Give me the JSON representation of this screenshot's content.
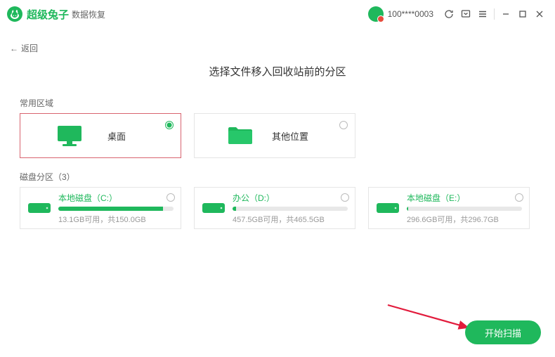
{
  "titlebar": {
    "brand": "超级兔子",
    "subbrand": "数据恢复",
    "user_id": "100****0003"
  },
  "back": {
    "label": "返回"
  },
  "page_title": "选择文件移入回收站前的分区",
  "sections": {
    "common_label": "常用区域",
    "partition_label": "磁盘分区（3）"
  },
  "common_cards": [
    {
      "name": "桌面",
      "selected": true
    },
    {
      "name": "其他位置",
      "selected": false
    }
  ],
  "drives": [
    {
      "name": "本地磁盘（C:）",
      "stat": "13.1GB可用，共150.0GB",
      "fill_pct": 91
    },
    {
      "name": "办公（D:）",
      "stat": "457.5GB可用，共465.5GB",
      "fill_pct": 3
    },
    {
      "name": "本地磁盘（E:）",
      "stat": "296.6GB可用，共296.7GB",
      "fill_pct": 1
    }
  ],
  "scan_btn": "开始扫描"
}
